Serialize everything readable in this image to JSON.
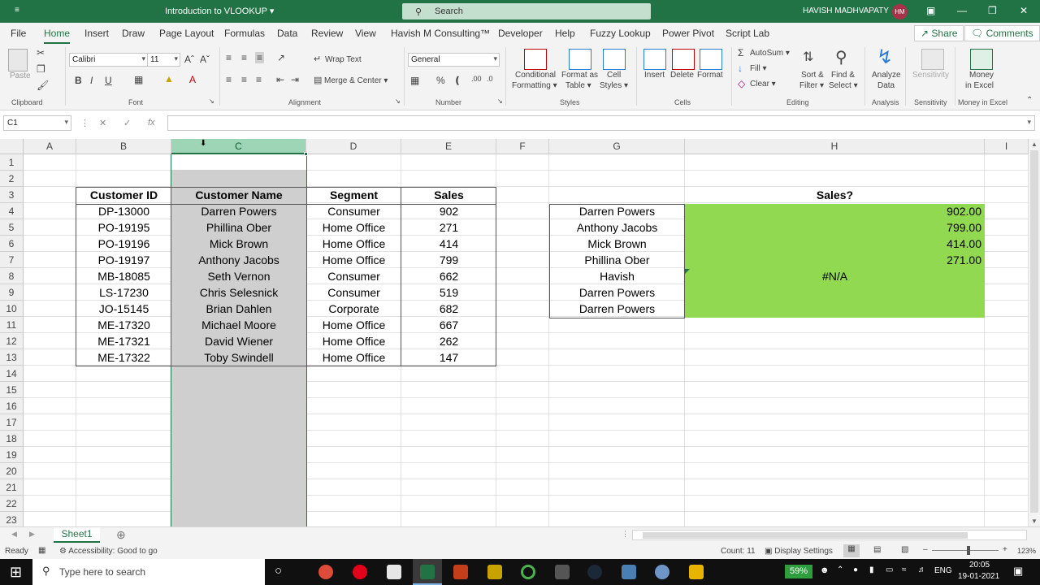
{
  "titlebar": {
    "doc_title": "Introduction to VLOOKUP",
    "search_placeholder": "Search",
    "user_name": "HAVISH MADHVAPATY",
    "user_initials": "HM",
    "brand_color": "#217346"
  },
  "tabs": [
    "File",
    "Home",
    "Insert",
    "Draw",
    "Page Layout",
    "Formulas",
    "Data",
    "Review",
    "View",
    "Havish M Consulting™",
    "Developer",
    "Help",
    "Fuzzy Lookup",
    "Power Pivot",
    "Script Lab"
  ],
  "active_tab": "Home",
  "share_label": "Share",
  "comments_label": "Comments",
  "ribbon": {
    "clipboard": {
      "paste": "Paste",
      "group": "Clipboard"
    },
    "font": {
      "name": "Calibri",
      "size": "11",
      "bold": "B",
      "italic": "I",
      "underline": "U",
      "group": "Font"
    },
    "alignment": {
      "wrap": "Wrap Text",
      "merge": "Merge & Center",
      "group": "Alignment"
    },
    "number": {
      "format": "General",
      "group": "Number"
    },
    "styles": {
      "conditional_1": "Conditional",
      "conditional_2": "Formatting",
      "format_table_1": "Format as",
      "format_table_2": "Table",
      "cell_styles_1": "Cell",
      "cell_styles_2": "Styles",
      "group": "Styles"
    },
    "cells": {
      "insert": "Insert",
      "delete": "Delete",
      "format": "Format",
      "group": "Cells"
    },
    "editing": {
      "autosum": "AutoSum",
      "fill": "Fill",
      "clear": "Clear",
      "sort_1": "Sort &",
      "sort_2": "Filter",
      "find_1": "Find &",
      "find_2": "Select",
      "group": "Editing"
    },
    "analysis": {
      "analyze_1": "Analyze",
      "analyze_2": "Data",
      "group": "Analysis"
    },
    "sensitivity": {
      "label": "Sensitivity",
      "group": "Sensitivity"
    },
    "money": {
      "label_1": "Money",
      "label_2": "in Excel",
      "group": "Money in Excel"
    }
  },
  "formula_bar": {
    "name_box": "C1",
    "fx": "fx",
    "formula": ""
  },
  "columns": [
    "A",
    "B",
    "C",
    "D",
    "E",
    "F",
    "G",
    "H",
    "I"
  ],
  "selected_column": "C",
  "rows": [
    "1",
    "2",
    "3",
    "4",
    "5",
    "6",
    "7",
    "8",
    "9",
    "10",
    "11",
    "12",
    "13",
    "14",
    "15",
    "16",
    "17",
    "18",
    "19",
    "20",
    "21",
    "22",
    "23"
  ],
  "table": {
    "headers": [
      "Customer ID",
      "Customer Name",
      "Segment",
      "Sales"
    ],
    "rows": [
      [
        "DP-13000",
        "Darren Powers",
        "Consumer",
        "902"
      ],
      [
        "PO-19195",
        "Phillina Ober",
        "Home Office",
        "271"
      ],
      [
        "PO-19196",
        "Mick Brown",
        "Home Office",
        "414"
      ],
      [
        "PO-19197",
        "Anthony Jacobs",
        "Home Office",
        "799"
      ],
      [
        "MB-18085",
        "Seth Vernon",
        "Consumer",
        "662"
      ],
      [
        "LS-17230",
        "Chris Selesnick",
        "Consumer",
        "519"
      ],
      [
        "JO-15145",
        "Brian Dahlen",
        "Corporate",
        "682"
      ],
      [
        "ME-17320",
        "Michael Moore",
        "Home Office",
        "667"
      ],
      [
        "ME-17321",
        "David Wiener",
        "Home Office",
        "262"
      ],
      [
        "ME-17322",
        "Toby Swindell",
        "Home Office",
        "147"
      ]
    ]
  },
  "lookup": {
    "header": "Sales?",
    "names": [
      "Darren Powers",
      "Anthony Jacobs",
      "Mick Brown",
      "Phillina Ober",
      "Havish",
      "Darren Powers",
      "Darren Powers"
    ],
    "results": [
      "902.00",
      "799.00",
      "414.00",
      "271.00",
      "#N/A",
      "",
      ""
    ],
    "fill_color": "#92d952"
  },
  "sheet_tab": "Sheet1",
  "status": {
    "ready": "Ready",
    "accessibility": "Accessibility: Good to go",
    "count": "Count: 11",
    "display_settings": "Display Settings",
    "zoom": "123%"
  },
  "taskbar": {
    "search_placeholder": "Type here to search",
    "battery": "59%",
    "lang": "ENG",
    "time": "20:05",
    "date": "19-01-2021"
  }
}
